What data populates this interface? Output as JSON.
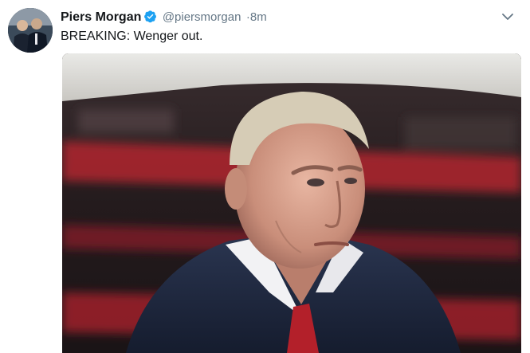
{
  "tweet": {
    "author": {
      "display_name": "Piers Morgan",
      "handle": "@piersmorgan",
      "verified_icon": "verified-badge-icon",
      "avatar_icon": "profile-photo"
    },
    "timestamp": "·8m",
    "text": "BREAKING: Wenger out.",
    "menu_icon": "chevron-down-icon",
    "media": {
      "type": "photo",
      "subject": "man in navy suit with red tie in stadium"
    }
  },
  "colors": {
    "text_primary": "#14171a",
    "text_secondary": "#657786",
    "verified_blue": "#1da1f2",
    "stadium_red": "#b0242d"
  }
}
